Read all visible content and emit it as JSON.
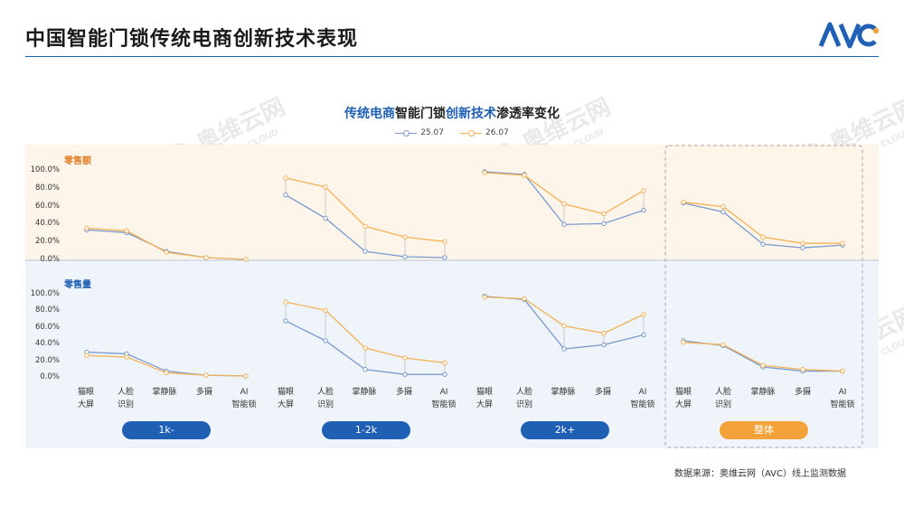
{
  "page_title": "中国智能门锁传统电商创新技术表现",
  "chart_title": {
    "part1": "传统电商",
    "part2": "智能门锁",
    "part3": "创新技术",
    "part4": "渗透率变化"
  },
  "legend": [
    "25.07",
    "26.07"
  ],
  "panel_labels": {
    "top": "零售额",
    "bottom": "零售量"
  },
  "y_ticks": [
    "100.0%",
    "80.0%",
    "60.0%",
    "40.0%",
    "20.0%",
    "0.0%"
  ],
  "x_labels": [
    [
      "猫眼",
      "大屏"
    ],
    [
      "人脸",
      "识别"
    ],
    [
      "掌静脉"
    ],
    [
      "多摄"
    ],
    [
      "AI",
      "智能锁"
    ]
  ],
  "last_x_label_group4": [
    "AI",
    "智能锁"
  ],
  "groups": [
    "1k-",
    "1-2k",
    "2k+",
    "整体"
  ],
  "source_note": "数据来源：奥维云网（AVC）线上监测数据",
  "watermark": {
    "brand": "AVC",
    "cn": "奥维云网",
    "en": "ALL VIEW CLOUD"
  },
  "colors": {
    "s2507": "#7a9acc",
    "s2607": "#f3b257",
    "accent_blue": "#1f5fb4",
    "accent_orange": "#f3a33a",
    "top_bg": "#fdf4ea",
    "bottom_bg": "#eef4fa"
  },
  "chart_data": {
    "type": "line",
    "categories": [
      "猫眼大屏",
      "人脸识别",
      "掌静脉",
      "多摄",
      "AI智能锁"
    ],
    "ylim": [
      0,
      100
    ],
    "panels": [
      {
        "name": "零售额",
        "groups": [
          {
            "name": "1k-",
            "series": [
              {
                "name": "25.07",
                "values": [
                  33,
                  30,
                  9,
                  2,
                  0
                ]
              },
              {
                "name": "26.07",
                "values": [
                  35,
                  32,
                  8,
                  2,
                  0
                ]
              }
            ]
          },
          {
            "name": "1-2k",
            "series": [
              {
                "name": "25.07",
                "values": [
                  72,
                  46,
                  9,
                  3,
                  2
                ]
              },
              {
                "name": "26.07",
                "values": [
                  91,
                  81,
                  37,
                  25,
                  20
                ]
              }
            ]
          },
          {
            "name": "2k+",
            "series": [
              {
                "name": "25.07",
                "values": [
                  98,
                  95,
                  39,
                  40,
                  55
                ]
              },
              {
                "name": "26.07",
                "values": [
                  97,
                  94,
                  62,
                  51,
                  77
                ]
              }
            ]
          },
          {
            "name": "整体",
            "series": [
              {
                "name": "25.07",
                "values": [
                  63,
                  53,
                  17,
                  13,
                  16
                ]
              },
              {
                "name": "26.07",
                "values": [
                  64,
                  59,
                  25,
                  18,
                  18
                ]
              }
            ]
          }
        ]
      },
      {
        "name": "零售量",
        "groups": [
          {
            "name": "1k-",
            "series": [
              {
                "name": "25.07",
                "values": [
                  29,
                  27,
                  6,
                  1,
                  0
                ]
              },
              {
                "name": "26.07",
                "values": [
                  25,
                  23,
                  4,
                  1,
                  0
                ]
              }
            ]
          },
          {
            "name": "1-2k",
            "series": [
              {
                "name": "25.07",
                "values": [
                  67,
                  43,
                  8,
                  2,
                  2
                ]
              },
              {
                "name": "26.07",
                "values": [
                  90,
                  80,
                  34,
                  22,
                  16
                ]
              }
            ]
          },
          {
            "name": "2k+",
            "series": [
              {
                "name": "25.07",
                "values": [
                  97,
                  93,
                  33,
                  38,
                  50
                ]
              },
              {
                "name": "26.07",
                "values": [
                  96,
                  94,
                  61,
                  52,
                  75
                ]
              }
            ]
          },
          {
            "name": "整体",
            "series": [
              {
                "name": "25.07",
                "values": [
                  43,
                  37,
                  11,
                  6,
                  6
                ]
              },
              {
                "name": "26.07",
                "values": [
                  41,
                  38,
                  13,
                  8,
                  6
                ]
              }
            ]
          }
        ]
      }
    ]
  }
}
